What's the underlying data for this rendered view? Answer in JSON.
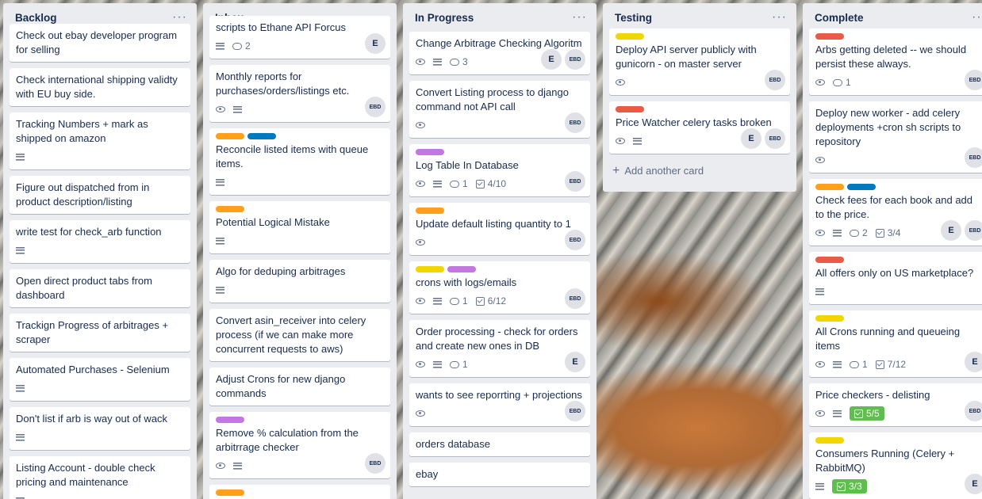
{
  "colors": {
    "green": "#61bd4f",
    "yellow": "#f2d600",
    "orange": "#ff9f1a",
    "red": "#eb5a46",
    "purple": "#c377e0",
    "blue": "#0079bf"
  },
  "icons": [
    "eye-icon",
    "description-icon",
    "comment-icon",
    "checklist-icon",
    "ellipsis-icon",
    "plus-icon"
  ],
  "lists": [
    {
      "title": "Backlog",
      "menu": "···",
      "cards": [
        {
          "title": "Check out ebay developer program for selling"
        },
        {
          "title": "Check international shipping validty with EU buy side."
        },
        {
          "title": "Tracking Numbers + mark as shipped on amazon",
          "desc": true
        },
        {
          "title": "Figure out dispatched from in product description/listing"
        },
        {
          "title": "write test for check_arb function",
          "desc": true
        },
        {
          "title": "Open direct product tabs from dashboard"
        },
        {
          "title": "Trackign Progress of arbitrages + scraper"
        },
        {
          "title": "Automated Purchases - Selenium",
          "desc": true
        },
        {
          "title": "Don't list if arb is way out of wack",
          "desc": true
        },
        {
          "title": "Listing Account - double check pricing and maintenance",
          "desc": true
        }
      ]
    },
    {
      "title": "Inbox",
      "menu": "···",
      "cards": [
        {
          "title": "scripts to Ethane API Forcus",
          "desc": true,
          "comments": "2",
          "members": [
            "E"
          ]
        },
        {
          "title": "Monthly reports for purchases/orders/listings etc.",
          "watch": true,
          "desc": true,
          "members": [
            "EBD"
          ]
        },
        {
          "title": "Reconcile listed items with queue items.",
          "labels": [
            "orange",
            "blue"
          ],
          "desc": true
        },
        {
          "title": "Potential Logical Mistake",
          "labels": [
            "orange"
          ],
          "desc": true
        },
        {
          "title": "Algo for deduping arbitrages",
          "desc": true
        },
        {
          "title": "Convert asin_receiver into celery process (if we can make more concurrent requests to aws)"
        },
        {
          "title": "Adjust Crons for new django commands"
        },
        {
          "title": "Remove % calculation from the arbitrrage checker",
          "labels": [
            "purple"
          ],
          "watch": true,
          "desc": true,
          "members": [
            "EBD"
          ]
        },
        {
          "title": "",
          "labels": [
            "orange"
          ]
        }
      ]
    },
    {
      "title": "In Progress",
      "menu": "···",
      "cards": [
        {
          "title": "Change Arbitrage Checking Algoritm",
          "watch": true,
          "desc": true,
          "comments": "3",
          "members": [
            "E",
            "EBD"
          ]
        },
        {
          "title": "Convert Listing process to django command not API call",
          "watch": true,
          "members": [
            "EBD"
          ]
        },
        {
          "title": "Log Table In Database",
          "labels": [
            "purple"
          ],
          "watch": true,
          "desc": true,
          "comments": "1",
          "checklist": "4/10",
          "members": [
            "EBD"
          ]
        },
        {
          "title": "Update default listing quantity to 1",
          "labels": [
            "orange"
          ],
          "watch": true,
          "members": [
            "EBD"
          ]
        },
        {
          "title": "crons with logs/emails",
          "labels": [
            "yellow",
            "purple"
          ],
          "watch": true,
          "desc": true,
          "comments": "1",
          "checklist": "6/12",
          "members": [
            "EBD"
          ]
        },
        {
          "title": "Order processing - check for orders and create new ones in DB",
          "watch": true,
          "desc": true,
          "comments": "1",
          "members": [
            "E"
          ]
        },
        {
          "title": "wants to see reporrting + projections",
          "watch": true,
          "members": [
            "EBD"
          ]
        },
        {
          "title": "orders database"
        },
        {
          "title": "ebay"
        }
      ]
    },
    {
      "title": "Testing",
      "menu": "···",
      "add_card": "Add another card",
      "cards": [
        {
          "title": "Deploy API server publicly with gunicorn - on master server",
          "labels": [
            "yellow"
          ],
          "watch": true,
          "members": [
            "EBD"
          ]
        },
        {
          "title": "Price Watcher celery tasks broken",
          "labels": [
            "red"
          ],
          "watch": true,
          "desc": true,
          "members": [
            "E",
            "EBD"
          ]
        }
      ]
    },
    {
      "title": "Complete",
      "menu": "···",
      "cards": [
        {
          "title": "Arbs getting deleted -- we should persist these always.",
          "labels": [
            "red"
          ],
          "watch": true,
          "comments": "1",
          "members": [
            "EBD"
          ]
        },
        {
          "title": "Deploy new worker - add celery deployments +cron sh scripts to repository",
          "watch": true,
          "members": [
            "EBD"
          ]
        },
        {
          "title": "Check fees for each book and add to the price.",
          "labels": [
            "orange",
            "blue"
          ],
          "watch": true,
          "desc": true,
          "comments": "2",
          "checklist": "3/4",
          "members": [
            "E",
            "EBD"
          ]
        },
        {
          "title": "All offers only on US marketplace?",
          "labels": [
            "red"
          ],
          "desc": true
        },
        {
          "title": "All Crons running and queueing items",
          "labels": [
            "yellow"
          ],
          "watch": true,
          "desc": true,
          "comments": "1",
          "checklist": "7/12",
          "members": [
            "E"
          ]
        },
        {
          "title": "Price checkers - delisting",
          "watch": true,
          "desc": true,
          "checklist_done": "5/5",
          "members": [
            "EBD"
          ]
        },
        {
          "title": "Consumers Running (Celery + RabbitMQ)",
          "labels": [
            "yellow"
          ],
          "desc": true,
          "checklist_done": "3/3",
          "members": [
            "E"
          ]
        }
      ]
    }
  ]
}
